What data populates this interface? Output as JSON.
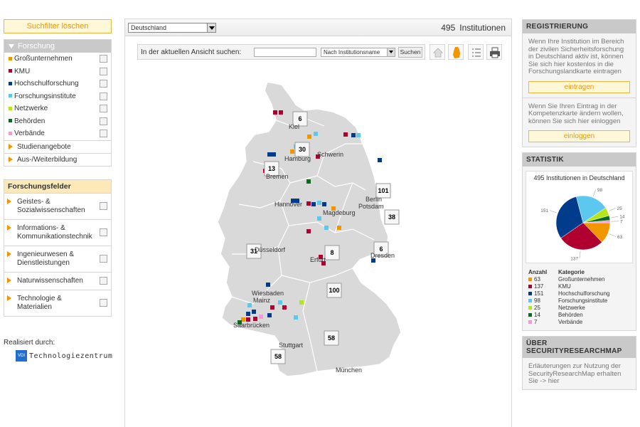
{
  "left": {
    "clear_filter": "Suchfilter löschen",
    "panel_title": "Forschung",
    "categories": [
      {
        "label": "Großunternehmen",
        "color": "#f29600"
      },
      {
        "label": "KMU",
        "color": "#b0002f"
      },
      {
        "label": "Hochschulforschung",
        "color": "#003b8c"
      },
      {
        "label": "Forschungsinstitute",
        "color": "#5cc8f0"
      },
      {
        "label": "Netzwerke",
        "color": "#b5e61d"
      },
      {
        "label": "Behörden",
        "color": "#0a6b1e"
      },
      {
        "label": "Verbände",
        "color": "#f29bd3"
      }
    ],
    "links": [
      "Studienangebote",
      "Aus-/Weiterbildung"
    ],
    "fields_title": "Forschungsfelder",
    "fields": [
      "Geistes- & Sozialwissenschaften",
      "Informations- & Kommunikationstechnik",
      "Ingenieurwesen & Dienstleistungen",
      "Naturwissenschaften",
      "Technologie & Materialien"
    ],
    "realized_by": "Realisiert durch:",
    "logo_mark": "VDI",
    "logo_text": "Technologiezentrum"
  },
  "center": {
    "region_select": "Deutschland",
    "count": "495",
    "count_label": "Institutionen",
    "search_label": "In der aktuellen Ansicht suchen:",
    "search_value": "",
    "search_mode": "Nach Institutionsname",
    "search_button": "Suchen"
  },
  "map": {
    "cities": [
      "Kiel",
      "Hamburg",
      "Schwerin",
      "Bremen",
      "Hannover",
      "Berlin",
      "Potsdam",
      "Magdeburg",
      "Düsseldorf",
      "Erfurt",
      "Dresden",
      "Wiesbaden",
      "Mainz",
      "Saarbrücken",
      "Stuttgart",
      "München"
    ],
    "clusters": [
      "6",
      "30",
      "13",
      "101",
      "38",
      "100",
      "8",
      "6",
      "31",
      "58",
      "58"
    ]
  },
  "right": {
    "reg_title": "REGISTRIERUNG",
    "reg_text1": "Wenn Ihre Institution im Bereich der zivilen Sicherheitsforschung in Deutschland aktiv ist, können Sie sich hier kostenlos in die Forschungslandkarte eintragen",
    "reg_btn1": "eintragen",
    "reg_text2": "Wenn Sie Ihren Eintrag in der Kompetenzkarte ändern wollen, können Sie sich hier einloggen",
    "reg_btn2": "einloggen",
    "stat_title": "STATISTIK",
    "chart_title": "495 Institutionen in Deutschland",
    "legend_head_count": "Anzahl",
    "legend_head_cat": "Kategorie",
    "about_title": "ÜBER SECURITYRESEARCHMAP",
    "about_text": "Erläuterungen zur Nutzung der SecurityResearchMap erhalten Sie -> hier"
  },
  "chart_data": {
    "type": "pie",
    "title": "495 Institutionen in Deutschland",
    "categories": [
      "Großunternehmen",
      "KMU",
      "Hochschulforschung",
      "Forschungsinstitute",
      "Netzwerke",
      "Behörden",
      "Verbände"
    ],
    "values": [
      63,
      137,
      151,
      98,
      25,
      14,
      7
    ],
    "colors": [
      "#f29600",
      "#b0002f",
      "#003b8c",
      "#5cc8f0",
      "#b5e61d",
      "#0a6b1e",
      "#f29bd3"
    ]
  }
}
